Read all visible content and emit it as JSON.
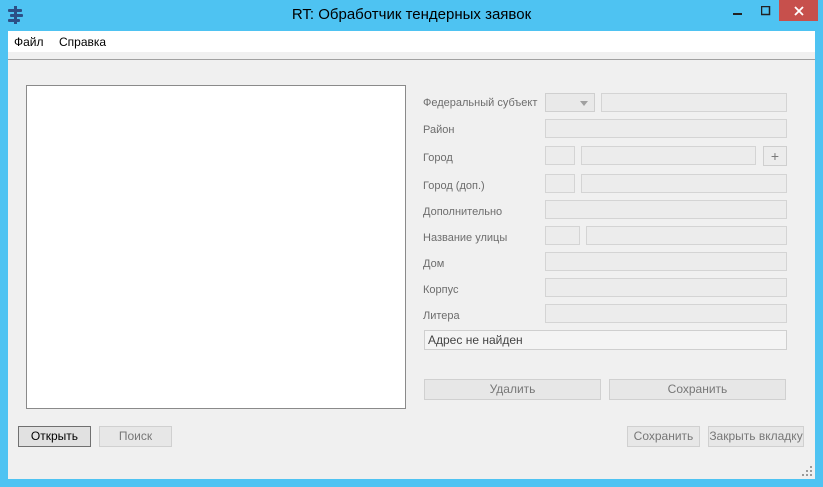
{
  "window": {
    "title": "RT: Обработчик тендерных заявок",
    "accent": "#4ec3f2",
    "close_color": "#c7504c"
  },
  "menu": {
    "file": "Файл",
    "help": "Справка"
  },
  "form": {
    "federal_subject": "Федеральный субъект",
    "district": "Район",
    "city": "Город",
    "city_extra": "Город (доп.)",
    "additional": "Дополнительно",
    "street": "Название улицы",
    "house": "Дом",
    "building": "Корпус",
    "letter": "Литера",
    "plus": "+",
    "status": "Адрес не найден",
    "delete_label": "Удалить",
    "save_label": "Сохранить"
  },
  "bottom": {
    "open_label": "Открыть",
    "search_label": "Поиск",
    "save_label": "Сохранить",
    "close_tab_label": "Закрыть вкладку"
  }
}
